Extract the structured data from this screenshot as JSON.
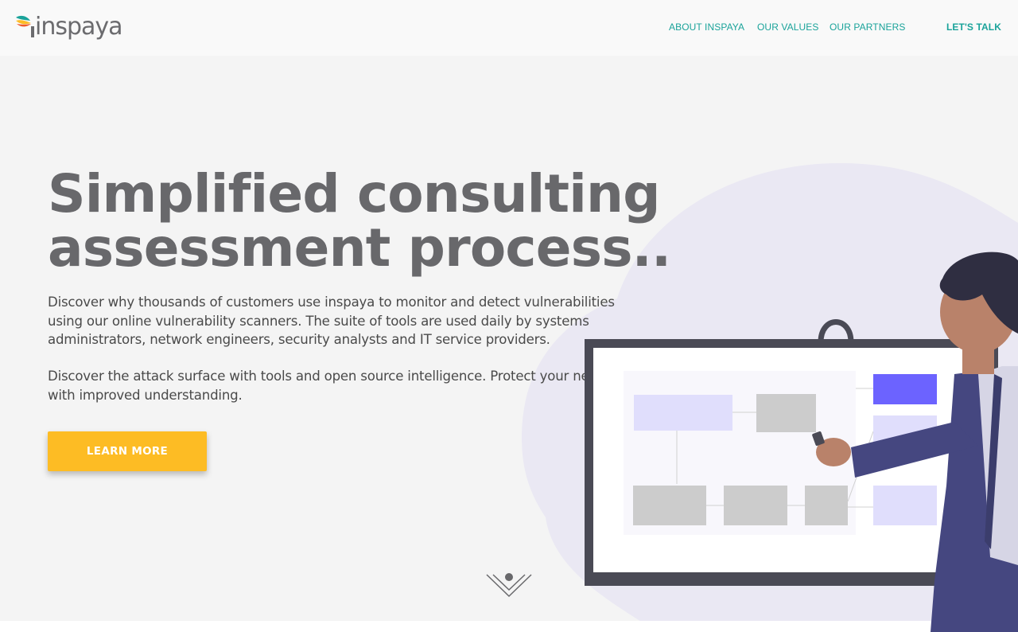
{
  "brand": {
    "name": "inspaya"
  },
  "nav": {
    "links": [
      {
        "label": "ABOUT INSPAYA"
      },
      {
        "label": "OUR VALUES"
      },
      {
        "label": "OUR PARTNERS"
      }
    ],
    "cta": "LET'S TALK"
  },
  "hero": {
    "headline_line1": "Simplified consulting",
    "headline_line2": "assessment process..",
    "paragraph1": "Discover why thousands of customers use inspaya to monitor and detect vulnerabilities using our online vulnerability scanners. The suite of tools are used daily by systems administrators, network engineers, security analysts and IT service providers.",
    "paragraph2_line1": "Discover the attack surface with tools and open source intelligence. Protect your network",
    "paragraph2_line2": "with improved understanding.",
    "cta_label": "LEARN MORE"
  },
  "colors": {
    "accent_teal": "#1aa39a",
    "cta_yellow": "#fdbc24",
    "headline_gray": "#68686b",
    "background": "#f4f4f4",
    "diagram_purple": "#6c63ff"
  },
  "icons": {
    "logo": "bird-logo-icon",
    "scroll": "chevron-down-icon",
    "illustration": "presenter-whiteboard-illustration"
  }
}
